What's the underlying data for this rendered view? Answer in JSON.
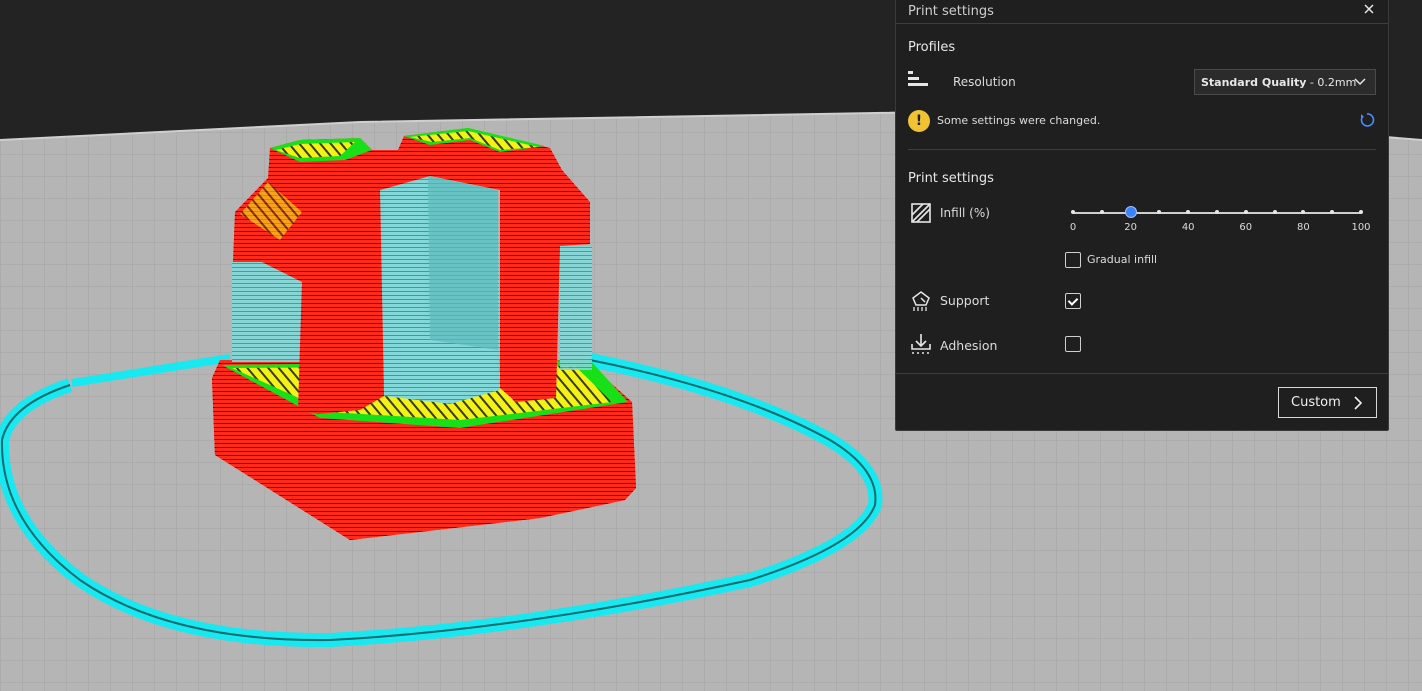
{
  "panel": {
    "title": "Print settings",
    "profiles": {
      "section_title": "Profiles",
      "resolution_label": "Resolution",
      "resolution_value_bold": "Standard Quality",
      "resolution_value_rest": " - 0.2mm",
      "warning_text": "Some settings were changed."
    },
    "settings": {
      "section_title": "Print settings",
      "infill": {
        "label": "Infill (%)",
        "value": 20,
        "tick_values": [
          0,
          10,
          20,
          30,
          40,
          50,
          60,
          70,
          80,
          90,
          100
        ],
        "tick_labels": [
          "0",
          "20",
          "40",
          "60",
          "80",
          "100"
        ],
        "gradual_label": "Gradual infill",
        "gradual_checked": false
      },
      "support": {
        "label": "Support",
        "checked": true
      },
      "adhesion": {
        "label": "Adhesion",
        "checked": false
      }
    },
    "custom_button_label": "Custom"
  },
  "icons": {
    "close": "close-icon",
    "resolution": "resolution-icon",
    "warning": "warning-icon",
    "reset": "reset-icon",
    "infill": "infill-icon",
    "support": "support-icon",
    "adhesion": "adhesion-icon",
    "dropdown": "chevron-down-icon",
    "custom": "chevron-right-icon"
  },
  "colors": {
    "model_wall": "#ff2a1a",
    "model_infill": "#f2f21a",
    "model_inner_wall": "#18e018",
    "support": "#7ed6d6",
    "skirt": "#18e8f0",
    "build_plate": "#b4b4b4",
    "accent": "#3b82f6",
    "warning": "#f1c232"
  }
}
